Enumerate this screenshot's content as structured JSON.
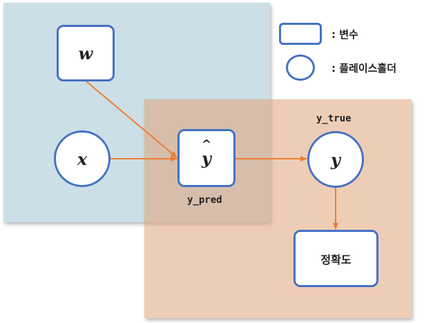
{
  "nodes": {
    "w": "w",
    "x": "x",
    "y_hat": "y",
    "y_hat_caret": "^",
    "y": "y",
    "accuracy": "정확도"
  },
  "labels": {
    "y_pred": "y_pred",
    "y_true": "y_true"
  },
  "legend": {
    "variable": ":  변수",
    "placeholder": ":  플레이스홀더"
  },
  "colors": {
    "blue_region": "#ccdfe6",
    "orange_region": "#e8b893",
    "node_border": "#4472c4",
    "arrow": "#ed7d31"
  }
}
